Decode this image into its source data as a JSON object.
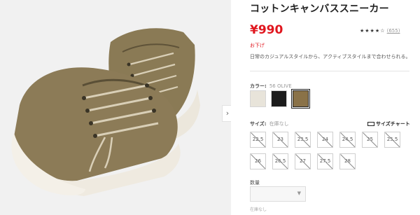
{
  "product": {
    "title": "コットンキャンバススニーカー",
    "price": "¥990",
    "price_tag": "お下げ",
    "rating_stars": "★★★★☆",
    "review_count": "(655)",
    "description": "日常のカジュアルスタイルから、アクティブスタイルまで合わせられる。"
  },
  "colors": {
    "label": "カラー:",
    "selected_name": "56 OLIVE",
    "swatches": [
      {
        "name": "off-white",
        "hex": "#e8e4da"
      },
      {
        "name": "black",
        "hex": "#1c1c1c"
      },
      {
        "name": "olive",
        "hex": "#8a7248"
      }
    ]
  },
  "sizes": {
    "label": "サイズ:",
    "selected_note": "在庫なし",
    "chart_link": "サイズチャート",
    "options": [
      "22.5",
      "23",
      "23.5",
      "24",
      "24.5",
      "25",
      "25.5",
      "26",
      "26.5",
      "27",
      "27.5",
      "28"
    ]
  },
  "quantity": {
    "label": "数量",
    "caret": "▼"
  },
  "stock_note": "在庫なし",
  "gallery": {
    "next_arrow": "›"
  }
}
